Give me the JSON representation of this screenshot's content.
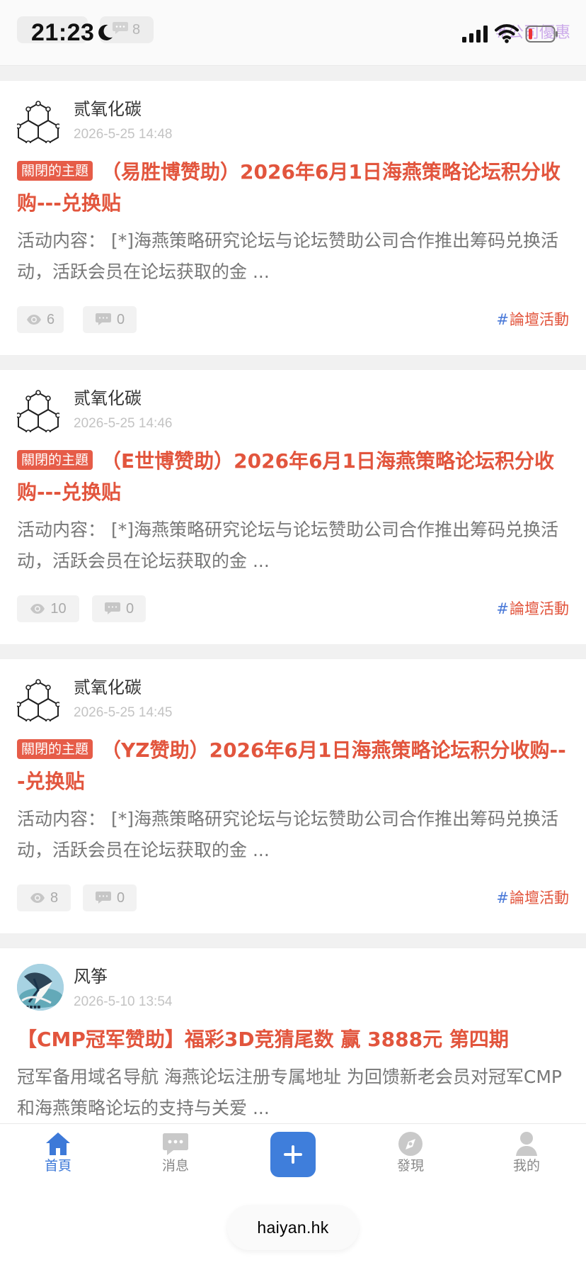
{
  "status_bar": {
    "time": "21:23",
    "ghost_comment_count": "8",
    "faint_tag": "#公司優惠"
  },
  "posts": [
    {
      "author": "贰氧化碳",
      "date": "2026-5-25 14:48",
      "badge": "關閉的主題",
      "title": "（易胜博赞助）2026年6月1日海燕策略论坛积分收购---兑换贴",
      "excerpt": "活动内容：  [*]海燕策略研究论坛与论坛赞助公司合作推出筹码兑换活动，活跃会员在论坛获取的金 ...",
      "views": "6",
      "comments": "0",
      "tag": "論壇活動"
    },
    {
      "author": "贰氧化碳",
      "date": "2026-5-25 14:46",
      "badge": "關閉的主題",
      "title": "（E世博赞助）2026年6月1日海燕策略论坛积分收购---兑换贴",
      "excerpt": "活动内容：  [*]海燕策略研究论坛与论坛赞助公司合作推出筹码兑换活动，活跃会员在论坛获取的金 ...",
      "views": "10",
      "comments": "0",
      "tag": "論壇活動"
    },
    {
      "author": "贰氧化碳",
      "date": "2026-5-25 14:45",
      "badge": "關閉的主題",
      "title": "（YZ赞助）2026年6月1日海燕策略论坛积分收购---兑换贴",
      "excerpt": "活动内容：  [*]海燕策略研究论坛与论坛赞助公司合作推出筹码兑换活动，活跃会员在论坛获取的金 ...",
      "views": "8",
      "comments": "0",
      "tag": "論壇活動"
    },
    {
      "author": "风筝",
      "date": "2026-5-10 13:54",
      "title": "【CMP冠军赞助】福彩3D竞猜尾数 赢 3888元 第四期",
      "excerpt": "冠军备用域名导航 海燕论坛注册专属地址 为回馈新老会员对冠军CMP 和海燕策略论坛的支持与关爱 ..."
    }
  ],
  "tabs": {
    "home": "首頁",
    "messages": "消息",
    "discover": "發現",
    "profile": "我的"
  },
  "address": {
    "domain": "haiyan.hk"
  },
  "colors": {
    "accent": "#e2553d",
    "active": "#3d79d8",
    "badge": "#e65c48"
  }
}
